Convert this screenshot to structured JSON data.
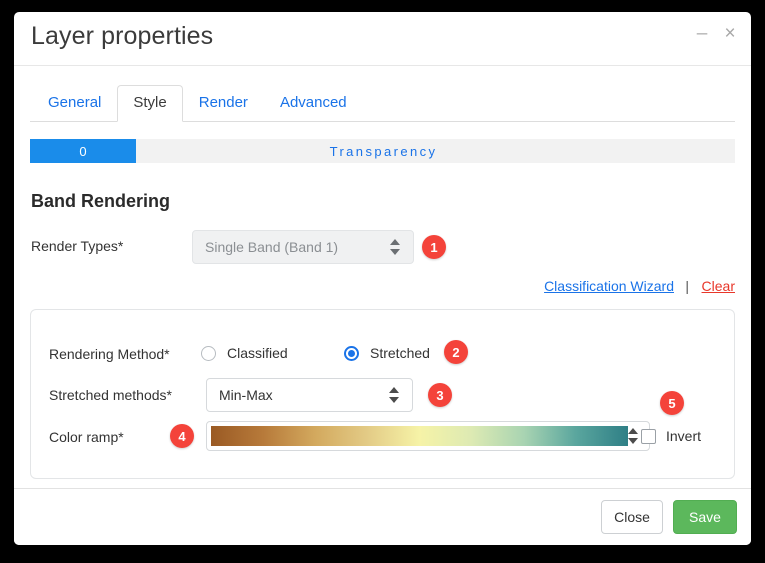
{
  "window": {
    "title": "Layer properties",
    "minimize_label": "–",
    "close_label": "×"
  },
  "tabs": [
    {
      "label": "General",
      "active": false
    },
    {
      "label": "Style",
      "active": true
    },
    {
      "label": "Render",
      "active": false
    },
    {
      "label": "Advanced",
      "active": false
    }
  ],
  "transparency": {
    "value": "0",
    "label": "Transparency",
    "fill_color": "#1a8cea",
    "track_color": "#f2f2f2",
    "label_color": "#1a73e8"
  },
  "band_rendering": {
    "section_title": "Band Rendering",
    "render_types": {
      "label": "Render Types*",
      "value": "Single Band (Band 1)",
      "disabled": true,
      "badge": "1"
    },
    "links": {
      "classification_wizard": "Classification Wizard",
      "separator": "|",
      "clear": "Clear",
      "wizard_color": "#1a73e8",
      "clear_color": "#e8372a"
    },
    "rendering_method": {
      "label": "Rendering Method*",
      "options": [
        {
          "label": "Classified",
          "selected": false
        },
        {
          "label": "Stretched",
          "selected": true
        }
      ],
      "badge": "2"
    },
    "stretched_methods": {
      "label": "Stretched methods*",
      "value": "Min-Max",
      "badge": "3"
    },
    "color_ramp": {
      "label": "Color ramp*",
      "badge": "4",
      "gradient_stops": [
        "#9a5a24",
        "#b77a3a",
        "#d3a95e",
        "#e3cb86",
        "#f6f3a7",
        "#ddeab3",
        "#a9d4b2",
        "#5aa69e",
        "#2f7f86"
      ]
    },
    "invert": {
      "label": "Invert",
      "checked": false,
      "badge": "5"
    }
  },
  "footer": {
    "close_label": "Close",
    "save_label": "Save",
    "save_color": "#5cb85c"
  }
}
